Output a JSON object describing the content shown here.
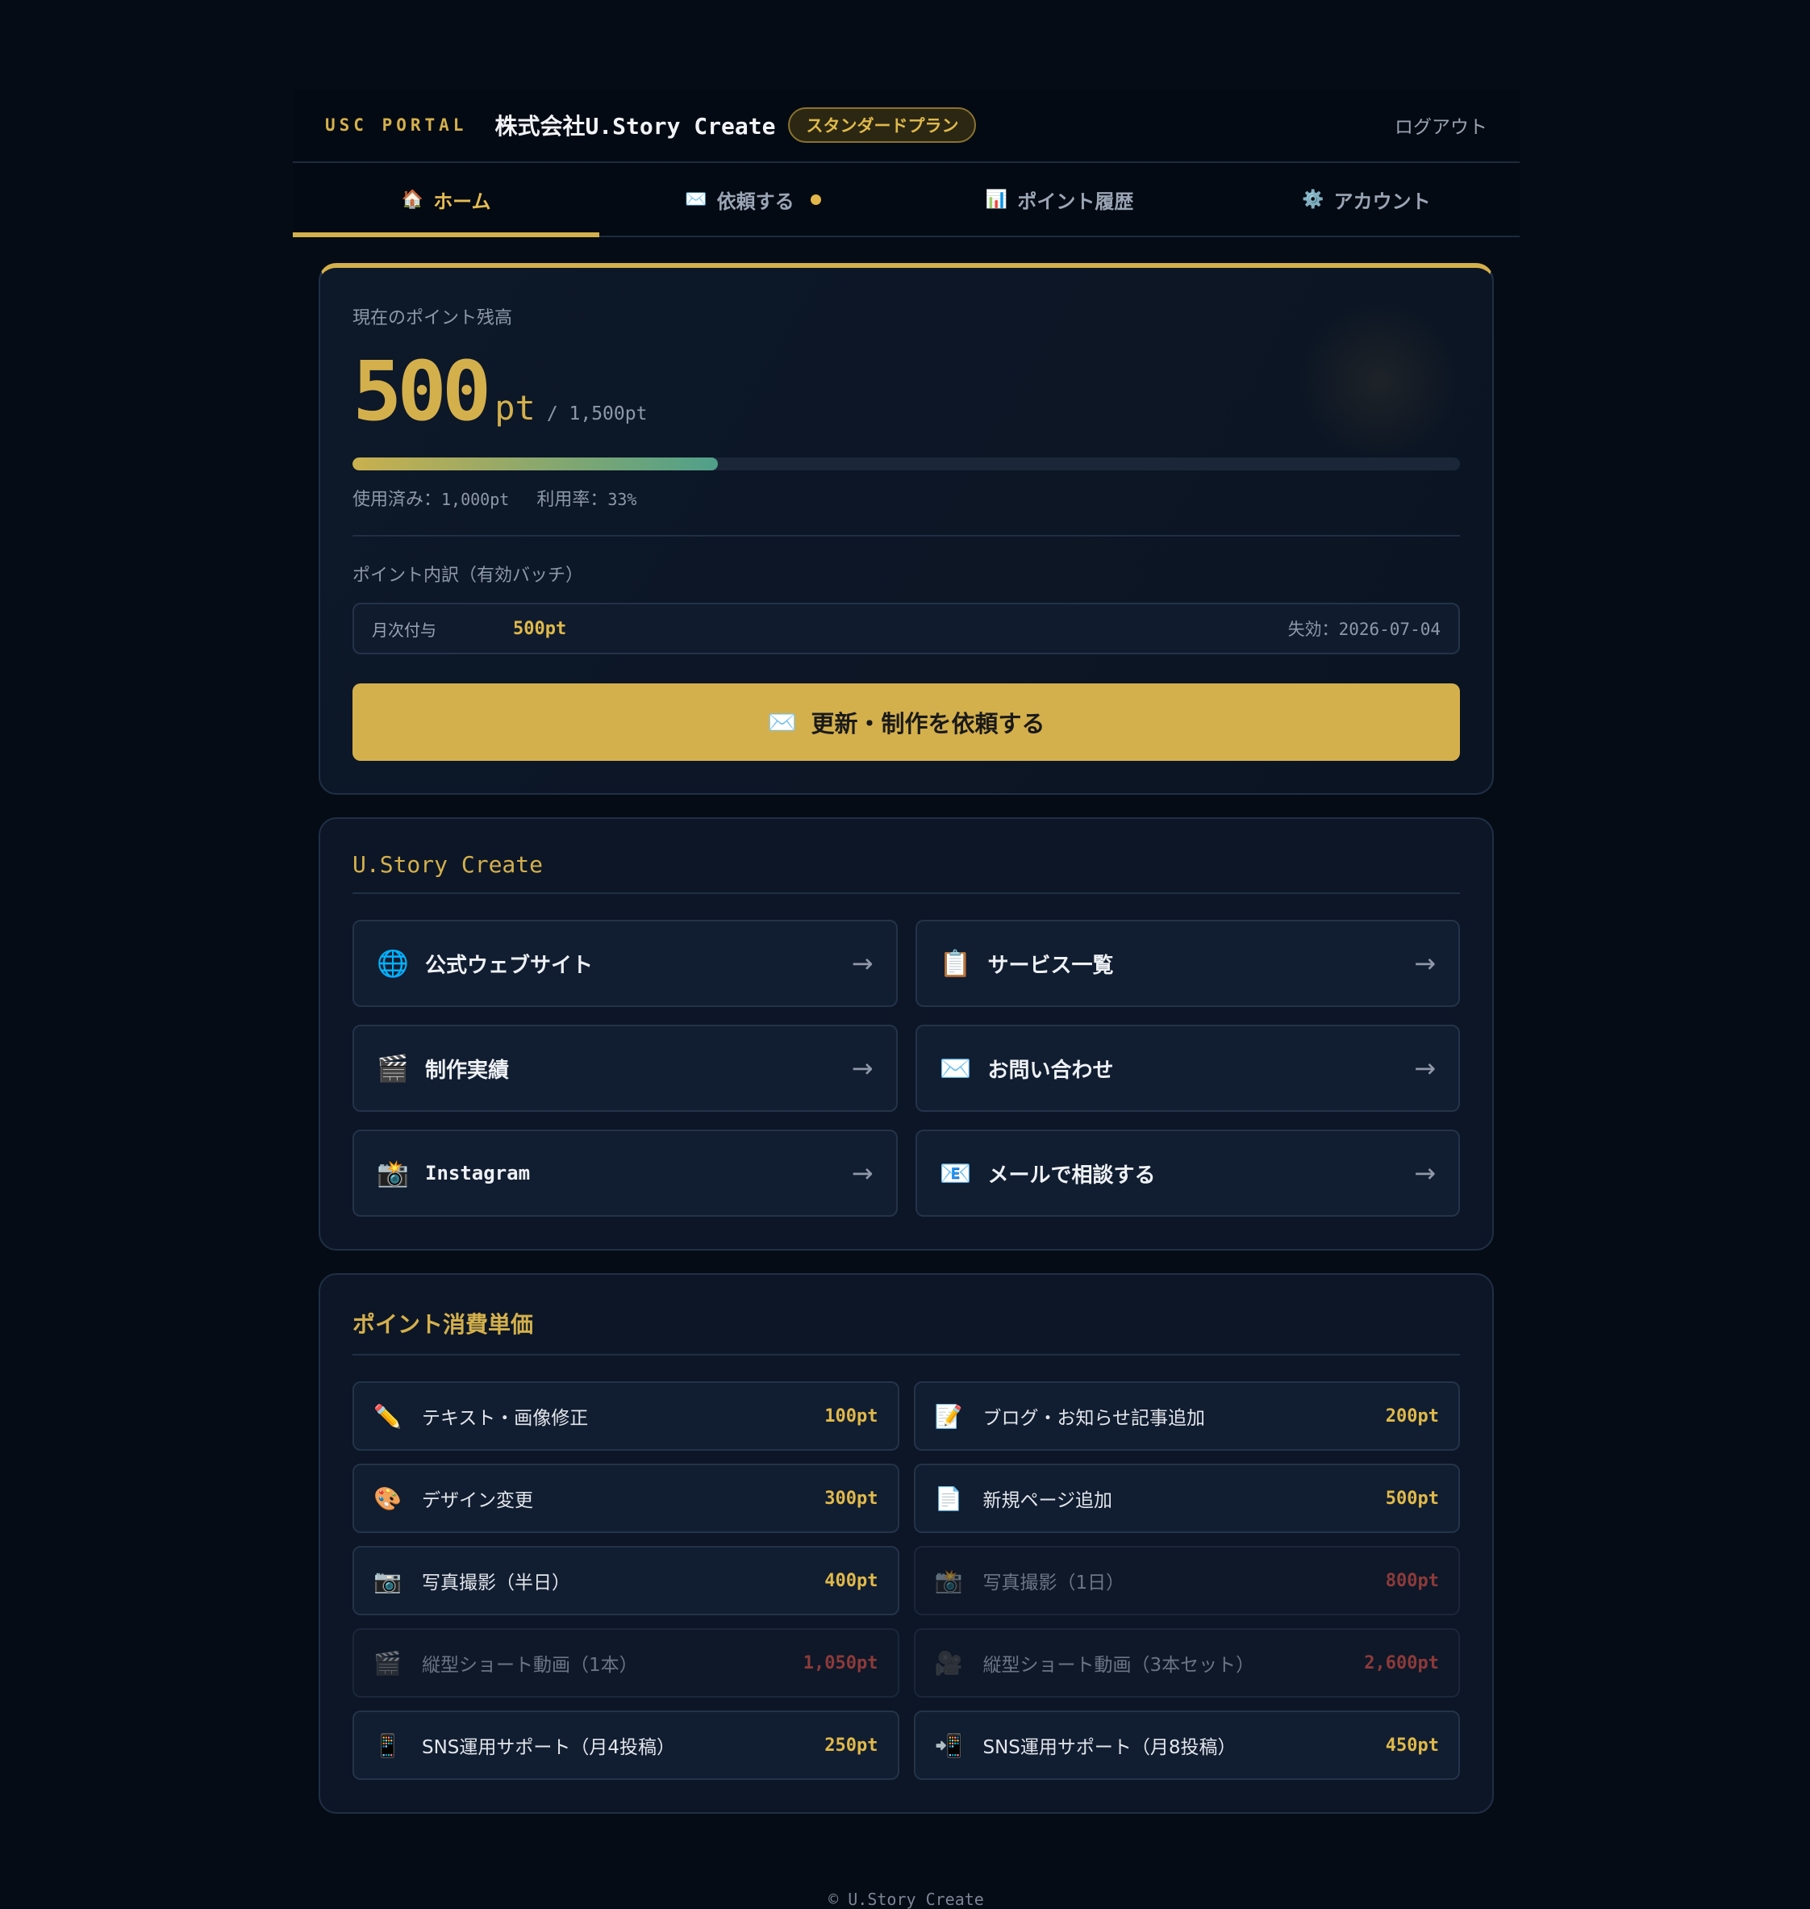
{
  "header": {
    "brand": "USC PORTAL",
    "company": "株式会社U.Story Create",
    "plan": "スタンダードプラン",
    "logout": "ログアウト"
  },
  "tabs": [
    {
      "icon": "🏠",
      "label": "ホーム",
      "active": true
    },
    {
      "icon": "✉️",
      "label": "依頼する",
      "dot": true
    },
    {
      "icon": "📊",
      "label": "ポイント履歴"
    },
    {
      "icon": "⚙️",
      "label": "アカウント"
    }
  ],
  "balance": {
    "label": "現在のポイント残高",
    "value": "500",
    "unit": "pt",
    "total": "/ 1,500pt",
    "used_fraction": 0.33,
    "used_label": "使用済み：",
    "used_value": "1,000pt",
    "rate_label": "利用率：",
    "rate_value": "33%",
    "breakdown_title": "ポイント内訳（有効バッチ）",
    "batch": {
      "label": "月次付与",
      "value": "500pt",
      "expiry_label": "失効：",
      "expiry": "2026-07-04"
    },
    "cta_icon": "✉️",
    "cta_label": "更新・制作を依頼する"
  },
  "links_section": {
    "title": "U.Story Create",
    "items": [
      {
        "icon": "🌐",
        "label": "公式ウェブサイト"
      },
      {
        "icon": "📋",
        "label": "サービス一覧"
      },
      {
        "icon": "🎬",
        "label": "制作実績"
      },
      {
        "icon": "✉️",
        "label": "お問い合わせ"
      },
      {
        "icon": "📸",
        "label": "Instagram"
      },
      {
        "icon": "📧",
        "label": "メールで相談する"
      }
    ],
    "arrow": "→"
  },
  "prices_section": {
    "title": "ポイント消費単価",
    "items": [
      {
        "icon": "✏️",
        "label": "テキスト・画像修正",
        "value": "100pt",
        "disabled": false
      },
      {
        "icon": "📝",
        "label": "ブログ・お知らせ記事追加",
        "value": "200pt",
        "disabled": false
      },
      {
        "icon": "🎨",
        "label": "デザイン変更",
        "value": "300pt",
        "disabled": false
      },
      {
        "icon": "📄",
        "label": "新規ページ追加",
        "value": "500pt",
        "disabled": false
      },
      {
        "icon": "📷",
        "label": "写真撮影（半日）",
        "value": "400pt",
        "disabled": false
      },
      {
        "icon": "📸",
        "label": "写真撮影（1日）",
        "value": "800pt",
        "disabled": true
      },
      {
        "icon": "🎬",
        "label": "縦型ショート動画（1本）",
        "value": "1,050pt",
        "disabled": true
      },
      {
        "icon": "🎥",
        "label": "縦型ショート動画（3本セット）",
        "value": "2,600pt",
        "disabled": true
      },
      {
        "icon": "📱",
        "label": "SNS運用サポート（月4投稿）",
        "value": "250pt",
        "disabled": false
      },
      {
        "icon": "📲",
        "label": "SNS運用サポート（月8投稿）",
        "value": "450pt",
        "disabled": false
      }
    ]
  },
  "footer": "© U.Story Create",
  "colors": {
    "accent": "#d4b04c",
    "background": "#050c16",
    "card": "#0c1626",
    "disabled_value": "#8d3a3a"
  }
}
